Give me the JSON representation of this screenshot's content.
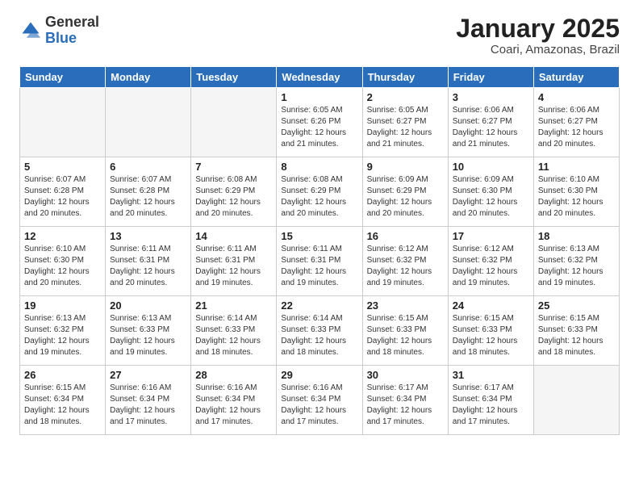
{
  "header": {
    "logo_general": "General",
    "logo_blue": "Blue",
    "month_title": "January 2025",
    "location": "Coari, Amazonas, Brazil"
  },
  "days_of_week": [
    "Sunday",
    "Monday",
    "Tuesday",
    "Wednesday",
    "Thursday",
    "Friday",
    "Saturday"
  ],
  "weeks": [
    [
      {
        "day": "",
        "info": ""
      },
      {
        "day": "",
        "info": ""
      },
      {
        "day": "",
        "info": ""
      },
      {
        "day": "1",
        "info": "Sunrise: 6:05 AM\nSunset: 6:26 PM\nDaylight: 12 hours and 21 minutes."
      },
      {
        "day": "2",
        "info": "Sunrise: 6:05 AM\nSunset: 6:27 PM\nDaylight: 12 hours and 21 minutes."
      },
      {
        "day": "3",
        "info": "Sunrise: 6:06 AM\nSunset: 6:27 PM\nDaylight: 12 hours and 21 minutes."
      },
      {
        "day": "4",
        "info": "Sunrise: 6:06 AM\nSunset: 6:27 PM\nDaylight: 12 hours and 20 minutes."
      }
    ],
    [
      {
        "day": "5",
        "info": "Sunrise: 6:07 AM\nSunset: 6:28 PM\nDaylight: 12 hours and 20 minutes."
      },
      {
        "day": "6",
        "info": "Sunrise: 6:07 AM\nSunset: 6:28 PM\nDaylight: 12 hours and 20 minutes."
      },
      {
        "day": "7",
        "info": "Sunrise: 6:08 AM\nSunset: 6:29 PM\nDaylight: 12 hours and 20 minutes."
      },
      {
        "day": "8",
        "info": "Sunrise: 6:08 AM\nSunset: 6:29 PM\nDaylight: 12 hours and 20 minutes."
      },
      {
        "day": "9",
        "info": "Sunrise: 6:09 AM\nSunset: 6:29 PM\nDaylight: 12 hours and 20 minutes."
      },
      {
        "day": "10",
        "info": "Sunrise: 6:09 AM\nSunset: 6:30 PM\nDaylight: 12 hours and 20 minutes."
      },
      {
        "day": "11",
        "info": "Sunrise: 6:10 AM\nSunset: 6:30 PM\nDaylight: 12 hours and 20 minutes."
      }
    ],
    [
      {
        "day": "12",
        "info": "Sunrise: 6:10 AM\nSunset: 6:30 PM\nDaylight: 12 hours and 20 minutes."
      },
      {
        "day": "13",
        "info": "Sunrise: 6:11 AM\nSunset: 6:31 PM\nDaylight: 12 hours and 20 minutes."
      },
      {
        "day": "14",
        "info": "Sunrise: 6:11 AM\nSunset: 6:31 PM\nDaylight: 12 hours and 19 minutes."
      },
      {
        "day": "15",
        "info": "Sunrise: 6:11 AM\nSunset: 6:31 PM\nDaylight: 12 hours and 19 minutes."
      },
      {
        "day": "16",
        "info": "Sunrise: 6:12 AM\nSunset: 6:32 PM\nDaylight: 12 hours and 19 minutes."
      },
      {
        "day": "17",
        "info": "Sunrise: 6:12 AM\nSunset: 6:32 PM\nDaylight: 12 hours and 19 minutes."
      },
      {
        "day": "18",
        "info": "Sunrise: 6:13 AM\nSunset: 6:32 PM\nDaylight: 12 hours and 19 minutes."
      }
    ],
    [
      {
        "day": "19",
        "info": "Sunrise: 6:13 AM\nSunset: 6:32 PM\nDaylight: 12 hours and 19 minutes."
      },
      {
        "day": "20",
        "info": "Sunrise: 6:13 AM\nSunset: 6:33 PM\nDaylight: 12 hours and 19 minutes."
      },
      {
        "day": "21",
        "info": "Sunrise: 6:14 AM\nSunset: 6:33 PM\nDaylight: 12 hours and 18 minutes."
      },
      {
        "day": "22",
        "info": "Sunrise: 6:14 AM\nSunset: 6:33 PM\nDaylight: 12 hours and 18 minutes."
      },
      {
        "day": "23",
        "info": "Sunrise: 6:15 AM\nSunset: 6:33 PM\nDaylight: 12 hours and 18 minutes."
      },
      {
        "day": "24",
        "info": "Sunrise: 6:15 AM\nSunset: 6:33 PM\nDaylight: 12 hours and 18 minutes."
      },
      {
        "day": "25",
        "info": "Sunrise: 6:15 AM\nSunset: 6:33 PM\nDaylight: 12 hours and 18 minutes."
      }
    ],
    [
      {
        "day": "26",
        "info": "Sunrise: 6:15 AM\nSunset: 6:34 PM\nDaylight: 12 hours and 18 minutes."
      },
      {
        "day": "27",
        "info": "Sunrise: 6:16 AM\nSunset: 6:34 PM\nDaylight: 12 hours and 17 minutes."
      },
      {
        "day": "28",
        "info": "Sunrise: 6:16 AM\nSunset: 6:34 PM\nDaylight: 12 hours and 17 minutes."
      },
      {
        "day": "29",
        "info": "Sunrise: 6:16 AM\nSunset: 6:34 PM\nDaylight: 12 hours and 17 minutes."
      },
      {
        "day": "30",
        "info": "Sunrise: 6:17 AM\nSunset: 6:34 PM\nDaylight: 12 hours and 17 minutes."
      },
      {
        "day": "31",
        "info": "Sunrise: 6:17 AM\nSunset: 6:34 PM\nDaylight: 12 hours and 17 minutes."
      },
      {
        "day": "",
        "info": ""
      }
    ]
  ]
}
